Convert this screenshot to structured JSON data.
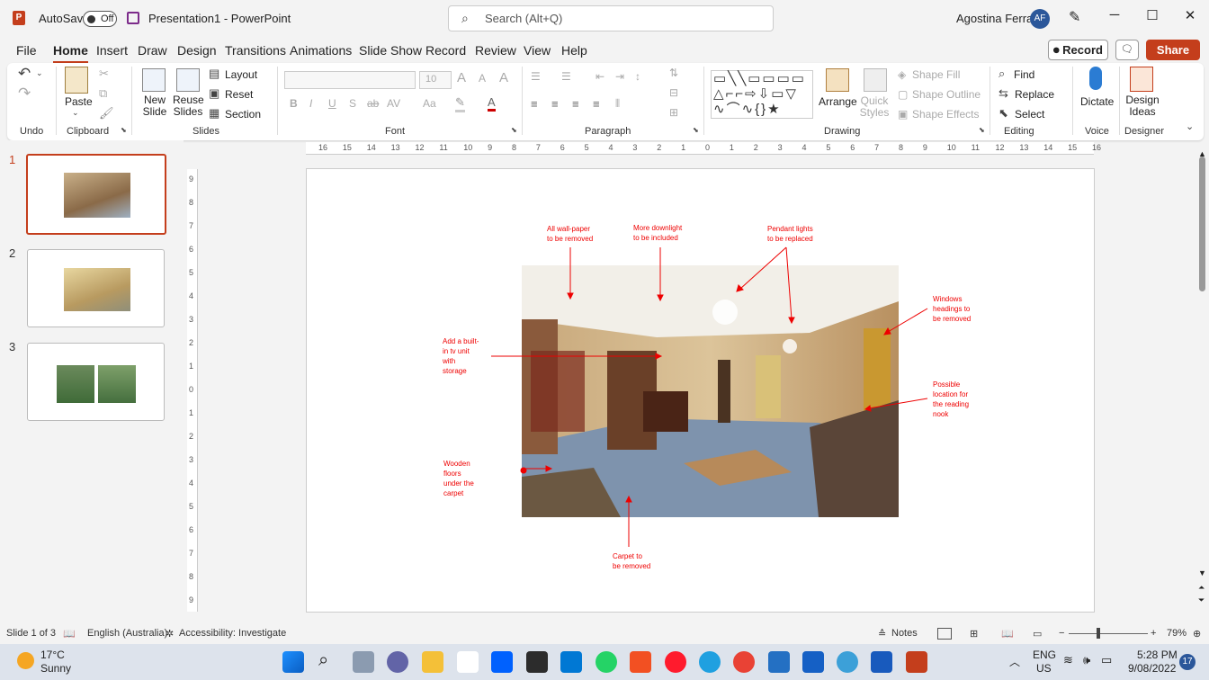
{
  "titlebar": {
    "autosave_label": "AutoSave",
    "autosave_state": "Off",
    "doc_title": "Presentation1 - PowerPoint",
    "search_placeholder": "Search (Alt+Q)",
    "user_name": "Agostina Ferrari",
    "user_initials": "AF",
    "minimize": "─",
    "maximize": "☐",
    "close": "✕"
  },
  "tabs": [
    "File",
    "Home",
    "Insert",
    "Draw",
    "Design",
    "Transitions",
    "Animations",
    "Slide Show",
    "Record",
    "Review",
    "View",
    "Help"
  ],
  "active_tab": "Home",
  "actions": {
    "record": "Record",
    "share": "Share"
  },
  "ribbon": {
    "undo": {
      "label": "Undo"
    },
    "clipboard": {
      "label": "Clipboard",
      "paste": "Paste"
    },
    "slides": {
      "label": "Slides",
      "new_slide": "New Slide",
      "reuse_slides": "Reuse Slides",
      "layout": "Layout",
      "reset": "Reset",
      "section": "Section"
    },
    "font": {
      "label": "Font",
      "font_size": "10"
    },
    "paragraph": {
      "label": "Paragraph"
    },
    "drawing": {
      "label": "Drawing",
      "arrange": "Arrange",
      "quick_styles": "Quick Styles",
      "shape_fill": "Shape Fill",
      "shape_outline": "Shape Outline",
      "shape_effects": "Shape Effects"
    },
    "editing": {
      "label": "Editing",
      "find": "Find",
      "replace": "Replace",
      "select": "Select"
    },
    "voice": {
      "label": "Voice",
      "dictate": "Dictate"
    },
    "designer": {
      "label": "Designer",
      "design_ideas": "Design Ideas"
    }
  },
  "slides_panel": {
    "numbers": [
      "1",
      "2",
      "3"
    ],
    "selected": 1
  },
  "ruler": {
    "horizontal": [
      "16",
      "15",
      "14",
      "13",
      "12",
      "11",
      "10",
      "9",
      "8",
      "7",
      "6",
      "5",
      "4",
      "3",
      "2",
      "1",
      "0",
      "1",
      "2",
      "3",
      "4",
      "5",
      "6",
      "7",
      "8",
      "9",
      "10",
      "11",
      "12",
      "13",
      "14",
      "15",
      "16"
    ],
    "vertical": [
      "9",
      "8",
      "7",
      "6",
      "5",
      "4",
      "3",
      "2",
      "1",
      "0",
      "1",
      "2",
      "3",
      "4",
      "5",
      "6",
      "7",
      "8",
      "9"
    ]
  },
  "slide": {
    "annotations": {
      "wallpaper": "All wall-paper\nto be removed",
      "downlight": "More downlight\nto be included",
      "pendant": "Pendant lights\nto be replaced",
      "windows": "Windows\nheadings to\nbe removed",
      "tv_unit": "Add a built-\nin tv unit\nwith\nstorage",
      "reading_nook": "Possible\nlocation for\nthe reading\nnook",
      "wooden_floors": "Wooden\nfloors\nunder the\ncarpet",
      "carpet": "Carpet to\nbe removed"
    }
  },
  "status": {
    "slide_count": "Slide 1 of 3",
    "language": "English (Australia)",
    "accessibility": "Accessibility: Investigate",
    "notes": "Notes",
    "zoom": "79%"
  },
  "taskbar": {
    "weather_temp": "17°C",
    "weather_desc": "Sunny",
    "lang_top": "ENG",
    "lang_bottom": "US",
    "time": "5:28 PM",
    "date": "9/08/2022",
    "notif_count": "17"
  },
  "colors": {
    "accent": "#c43e1c",
    "annotation": "#e00000",
    "taskbar": "#dde3ec"
  }
}
